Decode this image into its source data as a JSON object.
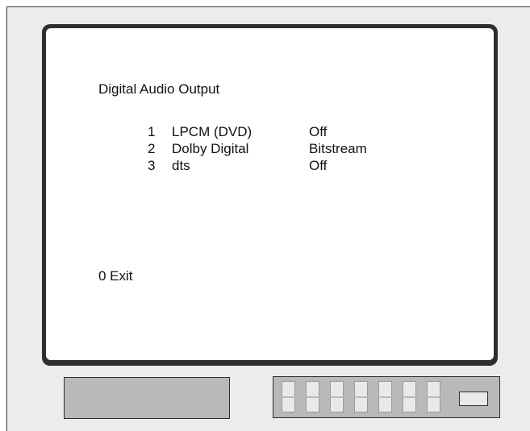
{
  "menu": {
    "title": "Digital Audio Output",
    "items": [
      {
        "number": "1",
        "label": "LPCM (DVD)",
        "value": "Off"
      },
      {
        "number": "2",
        "label": "Dolby Digital",
        "value": "Bitstream"
      },
      {
        "number": "3",
        "label": "dts",
        "value": "Off"
      }
    ],
    "exit_label": "0 Exit"
  },
  "colors": {
    "bezel": "#2e2e2e",
    "screen": "#ffffff",
    "body": "#ececec",
    "panel": "#b9b9b9",
    "button": "#e9e9e9"
  }
}
